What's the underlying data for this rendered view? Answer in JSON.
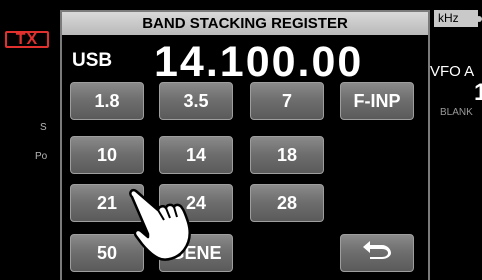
{
  "background": {
    "tx_label": "TX",
    "side_label_1": "S",
    "side_label_2": "Po",
    "unit_tag": "kHz",
    "vfo_label": "VFO A",
    "vfo_number": "1",
    "blank_label": "BLANK"
  },
  "dialog": {
    "title": "BAND STACKING REGISTER",
    "mode": "USB",
    "frequency": "14.100.00",
    "buttons": [
      "1.8",
      "3.5",
      "7",
      "F-INP",
      "10",
      "14",
      "18",
      "21",
      "24",
      "28",
      "50",
      "GENE"
    ],
    "back_icon": "return-icon"
  },
  "overlay": {
    "hand_icon": "pointing-hand-icon"
  }
}
